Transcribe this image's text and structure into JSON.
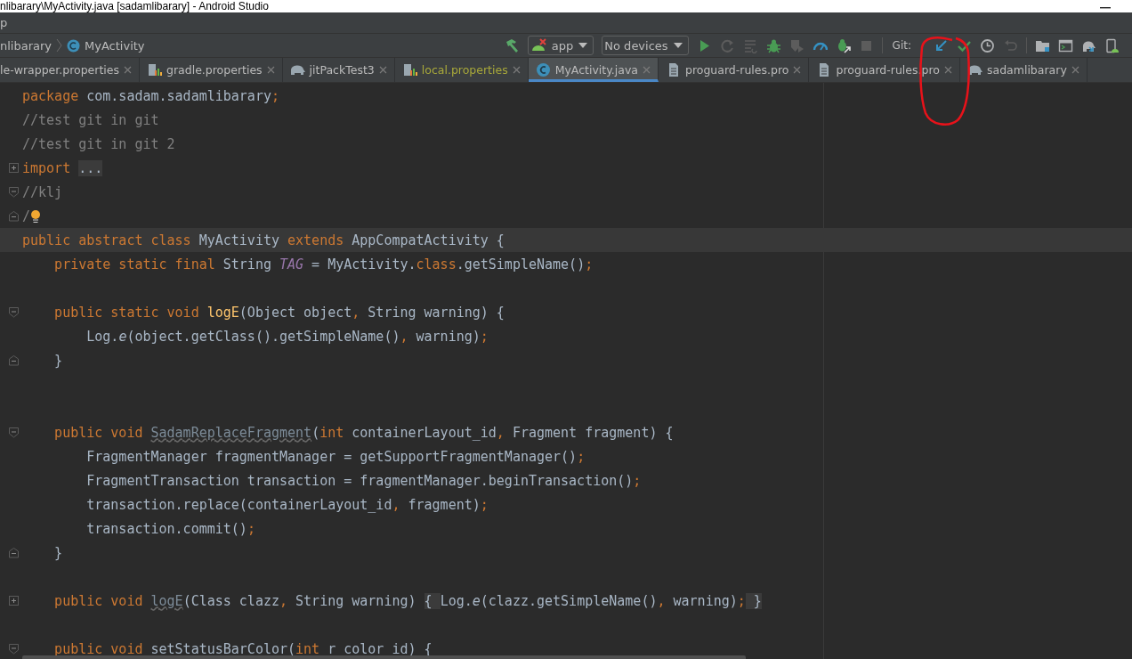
{
  "window": {
    "title": "nlibarary\\MyActivity.java [sadamlibarary] - Android Studio"
  },
  "menu_bar": {
    "items": [
      "p"
    ]
  },
  "breadcrumb": [
    {
      "label": "nlibarary",
      "kind": "module"
    },
    {
      "label": "MyActivity",
      "kind": "class"
    }
  ],
  "toolbar": {
    "items": [
      {
        "kind": "hammer",
        "disabled": false
      },
      {
        "kind": "config",
        "label": "app"
      },
      {
        "kind": "device",
        "label": "No devices"
      },
      {
        "kind": "run",
        "disabled": false
      },
      {
        "kind": "rerun",
        "disabled": true
      },
      {
        "kind": "apply",
        "disabled": true
      },
      {
        "kind": "debug",
        "disabled": false
      },
      {
        "kind": "profile",
        "disabled": true
      },
      {
        "kind": "speed",
        "disabled": false
      },
      {
        "kind": "attach",
        "disabled": false
      },
      {
        "kind": "stop",
        "disabled": true
      },
      {
        "kind": "separator"
      },
      {
        "kind": "label",
        "label": "Git:"
      },
      {
        "kind": "update",
        "disabled": false
      },
      {
        "kind": "commit",
        "disabled": false
      },
      {
        "kind": "history",
        "disabled": false
      },
      {
        "kind": "revert",
        "disabled": true
      },
      {
        "kind": "separator"
      },
      {
        "kind": "structure",
        "disabled": false
      },
      {
        "kind": "terminal",
        "disabled": false
      },
      {
        "kind": "sync",
        "disabled": false
      },
      {
        "kind": "avd",
        "disabled": false
      }
    ]
  },
  "tabs": [
    {
      "label": "le-wrapper.properties",
      "kind": "plain",
      "selected": false,
      "color": "#bbbbbb"
    },
    {
      "label": "gradle.properties",
      "kind": "props",
      "selected": false,
      "color": "#bbbbbb"
    },
    {
      "label": "jitPackTest3",
      "kind": "gradle",
      "selected": false,
      "color": "#bbbbbb"
    },
    {
      "label": "local.properties",
      "kind": "props",
      "selected": false,
      "color": "#a8a83a"
    },
    {
      "label": "MyActivity.java",
      "kind": "class",
      "selected": true,
      "color": "#bbbbbb"
    },
    {
      "label": "proguard-rules.pro",
      "kind": "file",
      "selected": false,
      "color": "#bbbbbb"
    },
    {
      "label": "proguard-rules.pro",
      "kind": "file",
      "selected": false,
      "color": "#bbbbbb"
    },
    {
      "label": "sadamlibarary",
      "kind": "gradle",
      "selected": false,
      "color": "#bbbbbb"
    }
  ],
  "editor": {
    "lines": [
      {
        "kind": "plain",
        "selected": false,
        "tokens": [
          {
            "kind": "kw",
            "text": "package "
          },
          {
            "kind": "txt",
            "text": "com.sadam.sadamlibarary"
          },
          {
            "kind": "punct",
            "text": ";"
          }
        ]
      },
      {
        "kind": "plain",
        "selected": false,
        "tokens": [
          {
            "kind": "comment",
            "text": "//test git in git"
          }
        ]
      },
      {
        "kind": "plain",
        "selected": false,
        "tokens": [
          {
            "kind": "comment",
            "text": "//test git in git 2"
          }
        ]
      },
      {
        "kind": "collapsed",
        "selected": false,
        "tokens": [
          {
            "kind": "kw",
            "text": "import "
          },
          {
            "kind": "folded",
            "text": "..."
          }
        ]
      },
      {
        "kind": "open",
        "selected": false,
        "tokens": [
          {
            "kind": "comment",
            "text": "//klj"
          }
        ]
      },
      {
        "kind": "close",
        "selected": false,
        "tokens": [
          {
            "kind": "comment",
            "text": "/"
          },
          {
            "kind": "bulb"
          }
        ]
      },
      {
        "kind": "plain",
        "selected": true,
        "tokens": [
          {
            "kind": "kw",
            "text": "public abstract class "
          },
          {
            "kind": "txt",
            "text": "MyActivity "
          },
          {
            "kind": "kw",
            "text": "extends "
          },
          {
            "kind": "txt",
            "text": "AppCompatActivity {"
          }
        ]
      },
      {
        "kind": "plain",
        "selected": false,
        "tokens": [
          {
            "kind": "kw",
            "text": "    private static final "
          },
          {
            "kind": "txt",
            "text": "String "
          },
          {
            "kind": "field",
            "text": "TAG"
          },
          {
            "kind": "txt",
            "text": " = MyActivity."
          },
          {
            "kind": "kw",
            "text": "class"
          },
          {
            "kind": "txt",
            "text": ".getSimpleName()"
          },
          {
            "kind": "punct",
            "text": ";"
          }
        ]
      },
      {
        "kind": "plain",
        "selected": false
      },
      {
        "kind": "open",
        "selected": false,
        "tokens": [
          {
            "kind": "kw",
            "text": "    public static void "
          },
          {
            "kind": "method",
            "text": "logE"
          },
          {
            "kind": "txt",
            "text": "(Object object"
          },
          {
            "kind": "punct",
            "text": ", "
          },
          {
            "kind": "txt",
            "text": "String warning) {"
          }
        ]
      },
      {
        "kind": "plain",
        "selected": false,
        "tokens": [
          {
            "kind": "txt",
            "text": "        Log."
          },
          {
            "kind": "static",
            "text": "e"
          },
          {
            "kind": "txt",
            "text": "(object.getClass().getSimpleName()"
          },
          {
            "kind": "punct",
            "text": ", "
          },
          {
            "kind": "txt",
            "text": "warning)"
          },
          {
            "kind": "punct",
            "text": ";"
          }
        ]
      },
      {
        "kind": "close",
        "selected": false,
        "tokens": [
          {
            "kind": "txt",
            "text": "    }"
          }
        ]
      },
      {
        "kind": "plain",
        "selected": false
      },
      {
        "kind": "plain",
        "selected": false
      },
      {
        "kind": "open",
        "selected": false,
        "tokens": [
          {
            "kind": "kw",
            "text": "    public void "
          },
          {
            "kind": "unused",
            "text": "SadamReplaceFragment"
          },
          {
            "kind": "txt",
            "text": "("
          },
          {
            "kind": "kw",
            "text": "int "
          },
          {
            "kind": "txt",
            "text": "containerLayout_id"
          },
          {
            "kind": "punct",
            "text": ", "
          },
          {
            "kind": "txt",
            "text": "Fragment fragment) {"
          }
        ]
      },
      {
        "kind": "plain",
        "selected": false,
        "tokens": [
          {
            "kind": "txt",
            "text": "        FragmentManager fragmentManager = getSupportFragmentManager()"
          },
          {
            "kind": "punct",
            "text": ";"
          }
        ]
      },
      {
        "kind": "plain",
        "selected": false,
        "tokens": [
          {
            "kind": "txt",
            "text": "        FragmentTransaction transaction = fragmentManager.beginTransaction()"
          },
          {
            "kind": "punct",
            "text": ";"
          }
        ]
      },
      {
        "kind": "plain",
        "selected": false,
        "tokens": [
          {
            "kind": "txt",
            "text": "        transaction.replace(containerLayout_id"
          },
          {
            "kind": "punct",
            "text": ", "
          },
          {
            "kind": "txt",
            "text": "fragment)"
          },
          {
            "kind": "punct",
            "text": ";"
          }
        ]
      },
      {
        "kind": "plain",
        "selected": false,
        "tokens": [
          {
            "kind": "txt",
            "text": "        transaction.commit()"
          },
          {
            "kind": "punct",
            "text": ";"
          }
        ]
      },
      {
        "kind": "close",
        "selected": false,
        "tokens": [
          {
            "kind": "txt",
            "text": "    }"
          }
        ]
      },
      {
        "kind": "plain",
        "selected": false
      },
      {
        "kind": "collapsed",
        "selected": false,
        "tokens": [
          {
            "kind": "kw",
            "text": "    public void "
          },
          {
            "kind": "unused",
            "text": "logE"
          },
          {
            "kind": "txt",
            "text": "(Class clazz"
          },
          {
            "kind": "punct",
            "text": ", "
          },
          {
            "kind": "txt",
            "text": "String warning) "
          },
          {
            "kind": "folded",
            "text": "{ "
          },
          {
            "kind": "txt",
            "text": "Log."
          },
          {
            "kind": "static",
            "text": "e"
          },
          {
            "kind": "txt",
            "text": "(clazz.getSimpleName()"
          },
          {
            "kind": "punct",
            "text": ", "
          },
          {
            "kind": "txt",
            "text": "warning)"
          },
          {
            "kind": "punct",
            "text": ";"
          },
          {
            "kind": "folded",
            "text": " }"
          }
        ]
      },
      {
        "kind": "plain",
        "selected": false
      },
      {
        "kind": "open",
        "selected": false,
        "tokens": [
          {
            "kind": "kw",
            "text": "    public void "
          },
          {
            "kind": "txt",
            "text": "setStatusBarColor("
          },
          {
            "kind": "kw",
            "text": "int "
          },
          {
            "kind": "txt",
            "text": "r color id) {"
          }
        ]
      }
    ]
  }
}
